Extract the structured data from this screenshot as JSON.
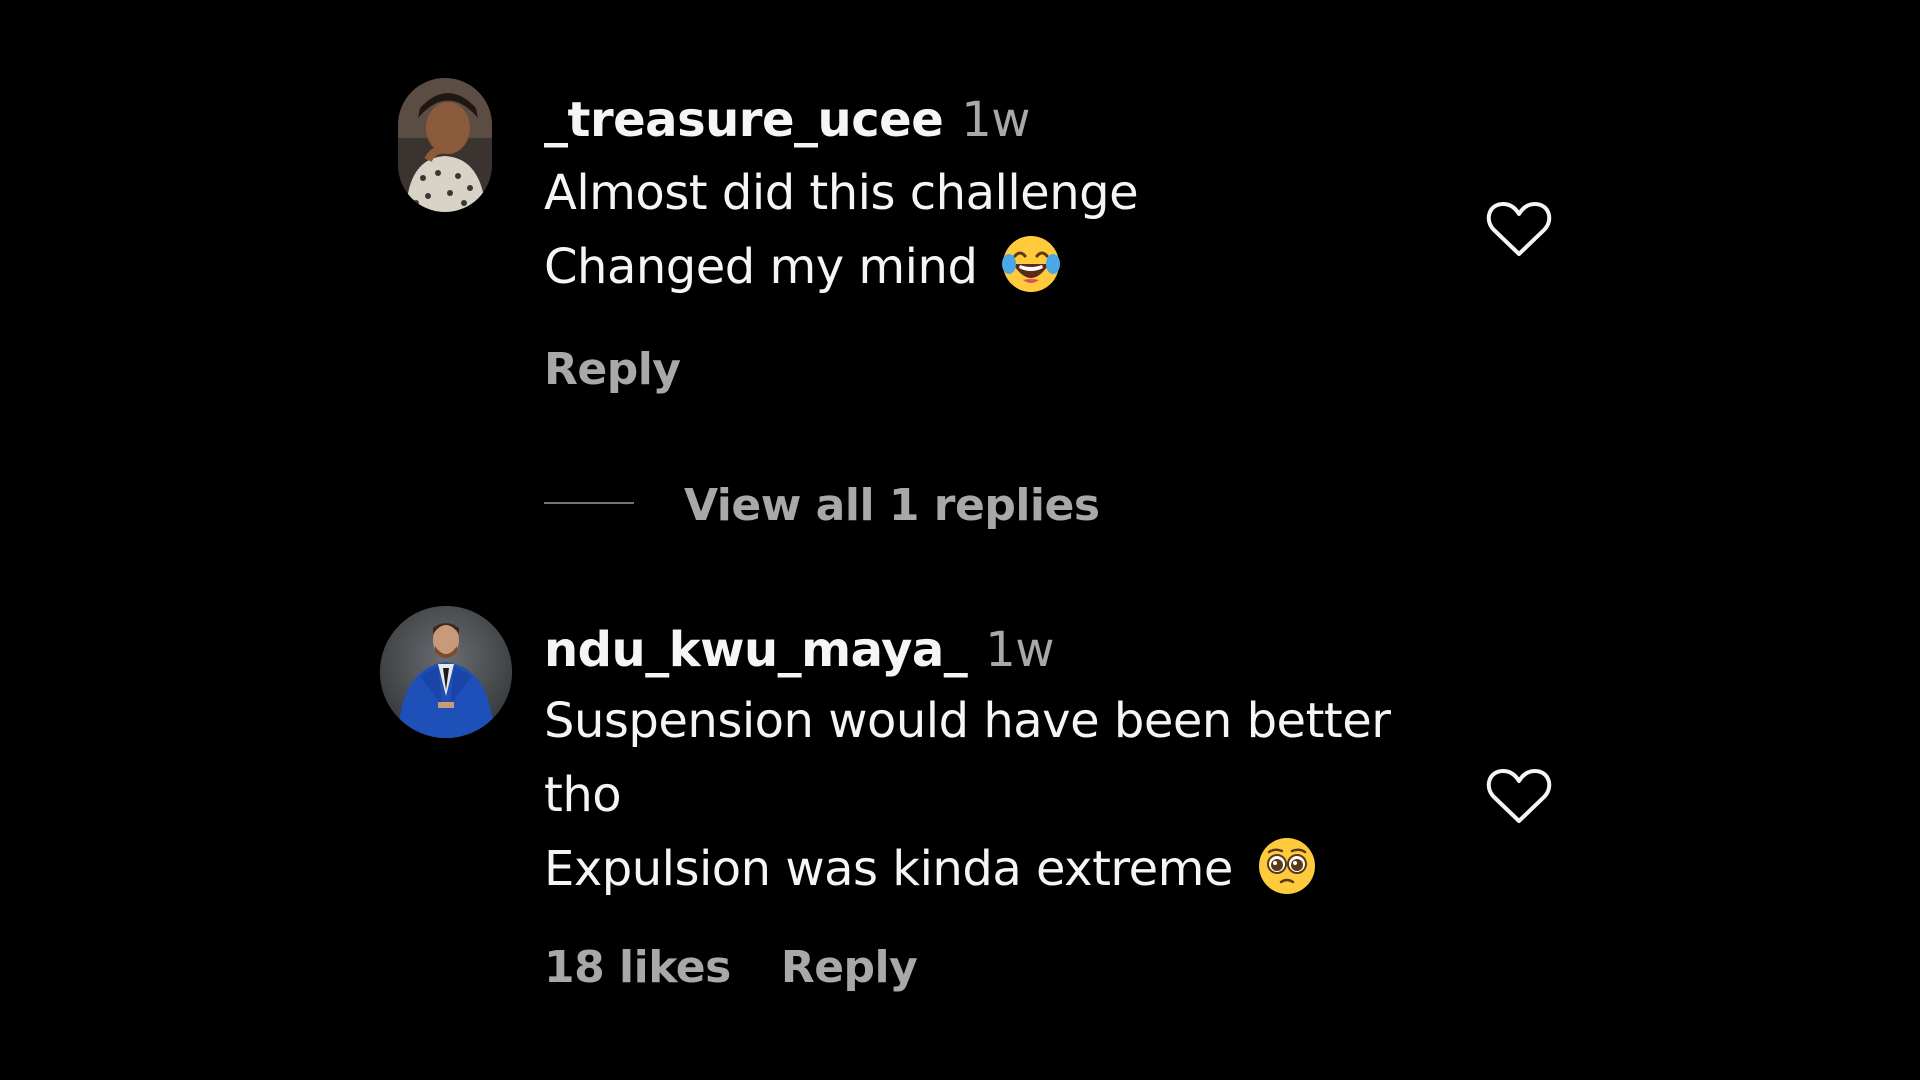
{
  "comments": [
    {
      "username": "_treasure_ucee",
      "time": "1w",
      "lines": [
        "Almost did this challenge",
        "Changed my mind"
      ],
      "emoji": "face-with-tears-of-joy",
      "actions": {
        "reply": "Reply"
      }
    },
    {
      "username": "ndu_kwu_maya_",
      "time": "1w",
      "lines": [
        "Suspension would have been better",
        "tho",
        "Expulsion was kinda extreme"
      ],
      "emoji": "pleading-face",
      "actions": {
        "likes": "18 likes",
        "reply": "Reply"
      }
    }
  ],
  "view_replies": "View all 1 replies",
  "colors": {
    "background": "#000000",
    "primary_text": "#f5f5f5",
    "secondary_text": "#a8a8a8",
    "divider": "#737373"
  },
  "icons": [
    "heart-outline-icon",
    "avatar"
  ]
}
